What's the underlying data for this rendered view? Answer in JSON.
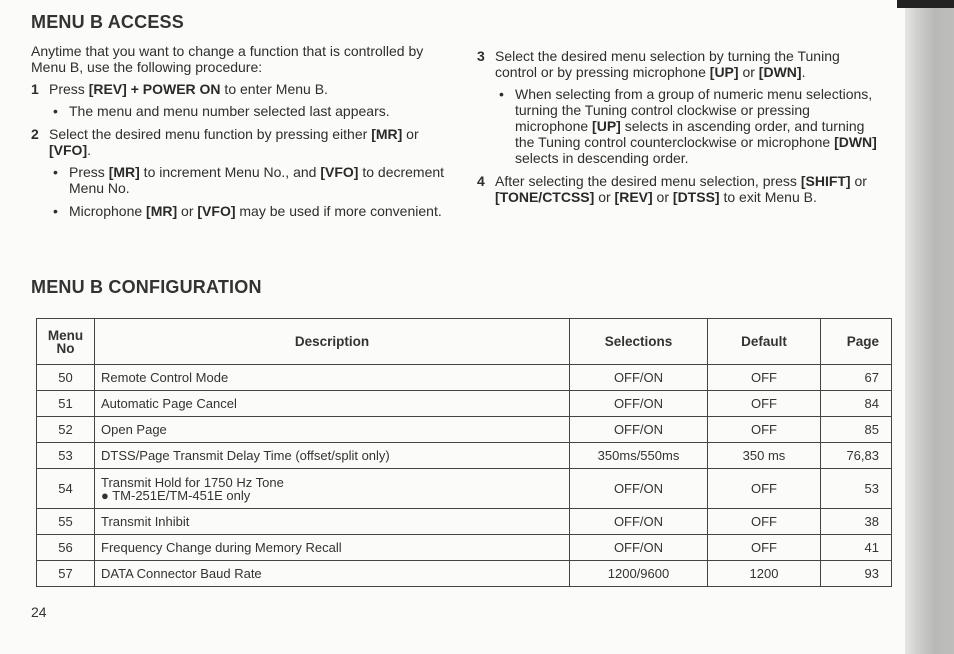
{
  "page_number": "24",
  "access": {
    "title": "MENU B ACCESS",
    "intro": "Anytime that you want to change a function that is controlled by Menu B, use the following procedure:",
    "steps": [
      {
        "num": "1",
        "pre": "Press ",
        "b1": "[REV] +  POWER ON",
        "post": " to enter Menu B."
      },
      {
        "num": "2",
        "pre": "Select the desired menu function by pressing either ",
        "b1": "[MR]",
        "mid": " or ",
        "b2": "[VFO]",
        "post": "."
      },
      {
        "num": "3",
        "pre": "Select the desired menu selection by turning the Tuning control or by pressing microphone ",
        "b1": "[UP]",
        "mid": " or ",
        "b2": "[DWN]",
        "post": "."
      },
      {
        "num": "4",
        "pre": "After selecting the desired menu selection, press ",
        "b1": "[SHIFT]",
        "m1": " or ",
        "b2": "[TONE/CTCSS]",
        "m2": " or ",
        "b3": "[REV]",
        "m3": " or ",
        "b4": "[DTSS]",
        "post": " to exit Menu B."
      }
    ],
    "bullets": {
      "s1": {
        "text": "The menu and menu number selected last appears."
      },
      "s2a": {
        "pre": "Press ",
        "b1": "[MR]",
        "mid": " to increment Menu No., and ",
        "b2": "[VFO]",
        "post": " to decrement Menu No."
      },
      "s2b": {
        "pre": "Microphone ",
        "b1": "[MR]",
        "mid": " or ",
        "b2": "[VFO]",
        "post": " may be used if more convenient."
      },
      "s3": {
        "pre": "When selecting from a group of numeric menu selections, turning the Tuning control clockwise or pressing microphone ",
        "b1": "[UP]",
        "mid": " selects in ascending order, and turning the Tuning control counterclockwise or microphone ",
        "b2": "[DWN]",
        "post": " selects in descending order."
      }
    },
    "bullet_glyph": "•"
  },
  "config": {
    "title": "MENU B CONFIGURATION",
    "headers": {
      "menu_no_1": "Menu",
      "menu_no_2": "No",
      "description": "Description",
      "selections": "Selections",
      "default": "Default",
      "page": "Page"
    },
    "rows": [
      {
        "no": "50",
        "desc": "Remote Control Mode",
        "sel": "OFF/ON",
        "def": "OFF",
        "page": "67"
      },
      {
        "no": "51",
        "desc": "Automatic Page Cancel",
        "sel": "OFF/ON",
        "def": "OFF",
        "page": "84"
      },
      {
        "no": "52",
        "desc": "Open Page",
        "sel": "OFF/ON",
        "def": "OFF",
        "page": "85"
      },
      {
        "no": "53",
        "desc": "DTSS/Page Transmit Delay Time (offset/split only)",
        "sel": "350ms/550ms",
        "def": "350 ms",
        "page": "76,83"
      },
      {
        "no": "54",
        "desc": "Transmit Hold for 1750 Hz Tone",
        "note": "●  TM-251E/TM-451E only",
        "sel": "OFF/ON",
        "def": "OFF",
        "page": "53"
      },
      {
        "no": "55",
        "desc": "Transmit Inhibit",
        "sel": "OFF/ON",
        "def": "OFF",
        "page": "38"
      },
      {
        "no": "56",
        "desc": "Frequency Change during Memory Recall",
        "sel": "OFF/ON",
        "def": "OFF",
        "page": "41"
      },
      {
        "no": "57",
        "desc": "DATA Connector Baud Rate",
        "sel": "1200/9600",
        "def": "1200",
        "page": "93"
      }
    ]
  }
}
